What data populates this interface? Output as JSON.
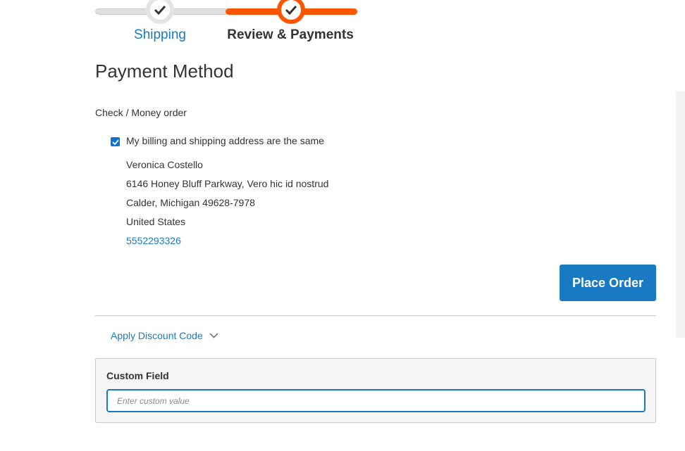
{
  "progress": {
    "steps": [
      {
        "label": "Shipping",
        "state": "complete"
      },
      {
        "label": "Review & Payments",
        "state": "active"
      }
    ],
    "active_color": "#ff5501",
    "link_color": "#1979c3"
  },
  "payment": {
    "title": "Payment Method",
    "method_label": "Check / Money order",
    "same_address_label": "My billing and shipping address are the same",
    "same_address_checked": true,
    "address": {
      "name": "Veronica Costello",
      "street": "6146 Honey Bluff Parkway, Vero hic id nostrud",
      "city_line": "Calder, Michigan 49628-7978",
      "country": "United States",
      "phone": "5552293326"
    },
    "place_order_label": "Place Order"
  },
  "discount": {
    "toggle_label": "Apply Discount Code",
    "icon": "chevron-down-icon"
  },
  "custom_field": {
    "label": "Custom Field",
    "value": "",
    "placeholder": "Enter custom value"
  }
}
